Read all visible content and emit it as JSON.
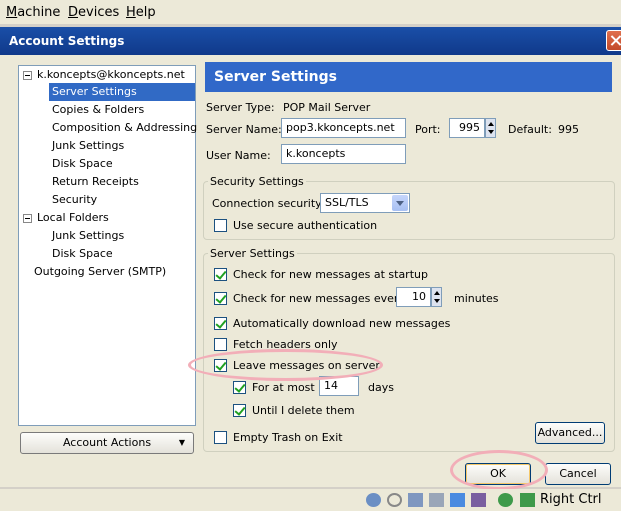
{
  "vm_menu": [
    "Machine",
    "Devices",
    "Help"
  ],
  "dialog": {
    "title": "Account Settings",
    "tree": {
      "account": "k.koncepts@kkoncepts.net",
      "account_items": [
        "Server Settings",
        "Copies & Folders",
        "Composition & Addressing",
        "Junk Settings",
        "Disk Space",
        "Return Receipts",
        "Security"
      ],
      "local_folders": "Local Folders",
      "local_items": [
        "Junk Settings",
        "Disk Space"
      ],
      "outgoing": "Outgoing Server (SMTP)"
    },
    "account_actions_label": "Account Actions",
    "header": "Server Settings",
    "server_type_label": "Server Type:",
    "server_type_value": "POP Mail Server",
    "server_name_label": "Server Name:",
    "server_name_value": "pop3.kkoncepts.net",
    "port_label": "Port:",
    "port_value": "995",
    "default_label": "Default:",
    "default_value": "995",
    "user_name_label": "User Name:",
    "user_name_value": "k.koncepts",
    "security_group": {
      "title": "Security Settings",
      "connection_label": "Connection security:",
      "connection_value": "SSL/TLS",
      "secure_auth": {
        "label": "Use secure authentication",
        "checked": false
      }
    },
    "server_group": {
      "title": "Server Settings",
      "check_startup": {
        "label": "Check for new messages at startup",
        "checked": true
      },
      "check_every": {
        "label": "Check for new messages every",
        "checked": true,
        "value": "10",
        "unit": "minutes"
      },
      "auto_download": {
        "label": "Automatically download new messages",
        "checked": true
      },
      "fetch_headers": {
        "label": "Fetch headers only",
        "checked": false
      },
      "leave_on_server": {
        "label": "Leave messages on server",
        "checked": true
      },
      "for_at_most": {
        "label": "For at most",
        "checked": true,
        "value": "14",
        "unit": "days"
      },
      "until_delete": {
        "label": "Until I delete them",
        "checked": true
      },
      "advanced_label": "Advanced...",
      "empty_trash": {
        "label": "Empty Trash on Exit",
        "checked": false
      }
    },
    "ok_label": "OK",
    "cancel_label": "Cancel"
  },
  "vm_status": {
    "host_key": "Right Ctrl"
  },
  "colors": {
    "selection": "#316ac5",
    "header_bar": "#3168c9",
    "titlebar": "#1a4fa8",
    "highlight": "#f2aeb8"
  }
}
